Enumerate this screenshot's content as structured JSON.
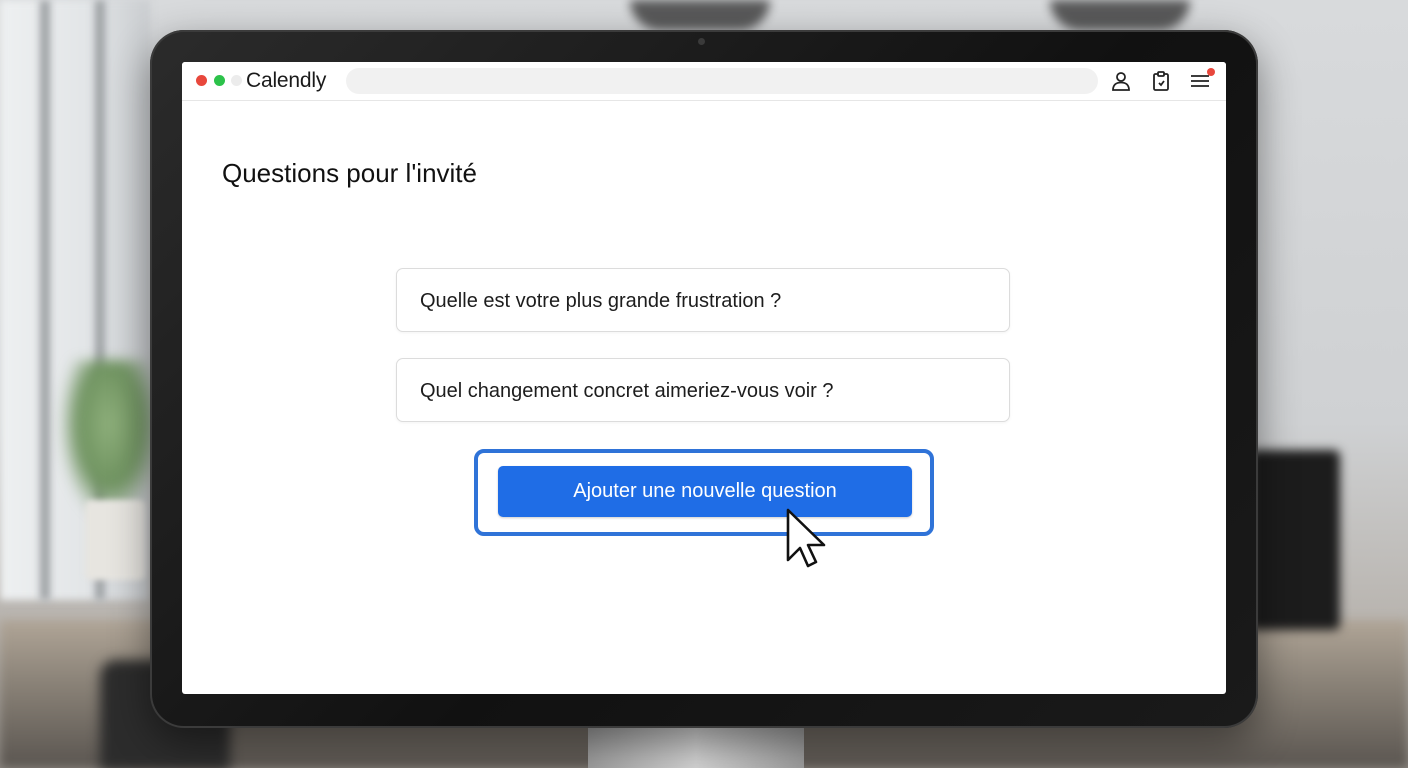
{
  "app": {
    "brand": "Calendly"
  },
  "header": {
    "icons": [
      "user-icon",
      "clipboard-icon",
      "menu-icon"
    ],
    "notification_color": "#e8473c"
  },
  "main": {
    "title": "Questions pour l'invité",
    "questions": [
      {
        "text": "Quelle est votre plus grande frustration ?"
      },
      {
        "text": "Quel changement concret aimeriez-vous voir ?"
      }
    ],
    "add_button_label": "Ajouter une nouvelle question"
  },
  "colors": {
    "accent": "#1f6de6",
    "focus_ring": "#2f73d8"
  }
}
